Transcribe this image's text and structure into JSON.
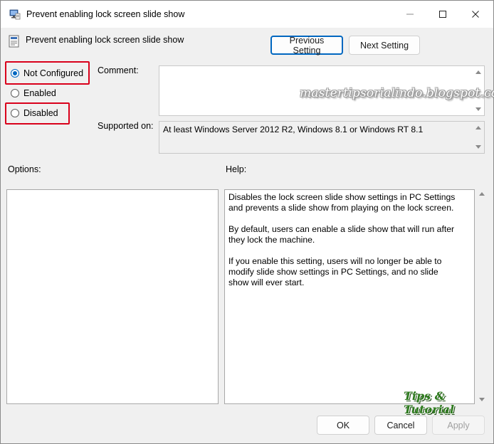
{
  "window": {
    "title": "Prevent enabling lock screen slide show"
  },
  "header": {
    "title": "Prevent enabling lock screen slide show",
    "previous_setting": "Previous Setting",
    "next_setting": "Next Setting"
  },
  "state": {
    "options": [
      {
        "label": "Not Configured",
        "checked": true
      },
      {
        "label": "Enabled",
        "checked": false
      },
      {
        "label": "Disabled",
        "checked": false
      }
    ]
  },
  "comment": {
    "label": "Comment:",
    "value": ""
  },
  "supported": {
    "label": "Supported on:",
    "value": "At least Windows Server 2012 R2, Windows 8.1 or Windows RT 8.1"
  },
  "options_panel": {
    "label": "Options:"
  },
  "help_panel": {
    "label": "Help:",
    "paragraphs": [
      "Disables the lock screen slide show settings in PC Settings and prevents a slide show from playing on the lock screen.",
      "By default, users can enable a slide show that will run after they lock the machine.",
      "If you enable this setting, users will no longer be able to modify slide show settings in PC Settings, and no slide show will ever start."
    ]
  },
  "footer": {
    "ok": "OK",
    "cancel": "Cancel",
    "apply": "Apply"
  },
  "watermarks": {
    "blog": "mastertipsorialindo.blogspot.com",
    "logo": "Tips & Tutorial"
  },
  "colors": {
    "accent": "#0067c0",
    "highlight": "#d9001b"
  }
}
